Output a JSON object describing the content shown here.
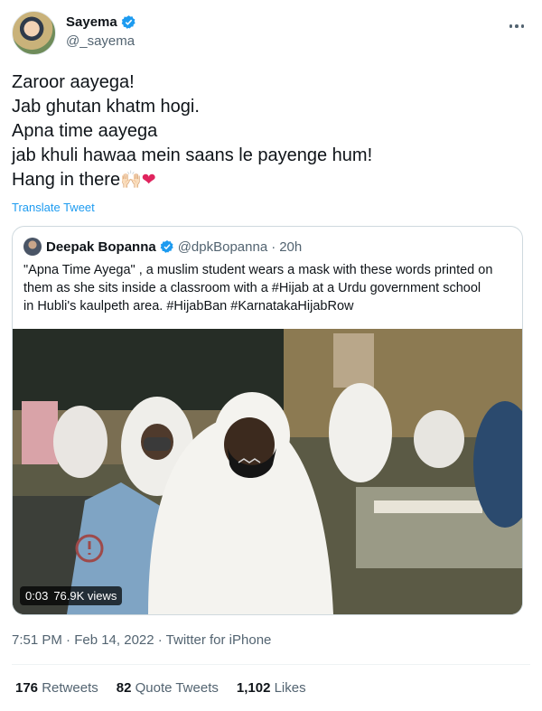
{
  "author": {
    "display_name": "Sayema",
    "handle": "@_sayema"
  },
  "tweet": {
    "lines": [
      "Zaroor aayega!",
      "Jab ghutan khatm hogi.",
      "Apna time aayega",
      "jab khuli hawaa mein saans le payenge hum!",
      "Hang in there"
    ],
    "emoji_hands": "🙌🏻",
    "emoji_heart": "❤",
    "translate_label": "Translate Tweet"
  },
  "quoted": {
    "display_name": "Deepak Bopanna",
    "handle": "@dpkBopanna",
    "separator": "·",
    "age": "20h",
    "text_lines": [
      "\"Apna Time Ayega\" , a muslim student wears a mask with these words printed on",
      "them as she sits inside a classroom with a #Hijab at a Urdu government school",
      "in Hubli's kaulpeth area.  #HijabBan #KarnatakaHijabRow"
    ],
    "video": {
      "duration": "0:03",
      "views": "76.9K views"
    }
  },
  "meta": {
    "timestamp": "7:51 PM · Feb 14, 2022 · Twitter for iPhone"
  },
  "stats": [
    {
      "count": "176",
      "label": "Retweets"
    },
    {
      "count": "82",
      "label": "Quote Tweets"
    },
    {
      "count": "1,102",
      "label": "Likes"
    }
  ],
  "colors": {
    "accent": "#1d9bf0",
    "text": "#0f1419",
    "muted": "#536471",
    "border": "#cfd9de",
    "heart": "#e0245e"
  },
  "icons": [
    "verified-badge-icon",
    "more-options-icon",
    "hands-emoji-icon",
    "heart-emoji-icon"
  ]
}
